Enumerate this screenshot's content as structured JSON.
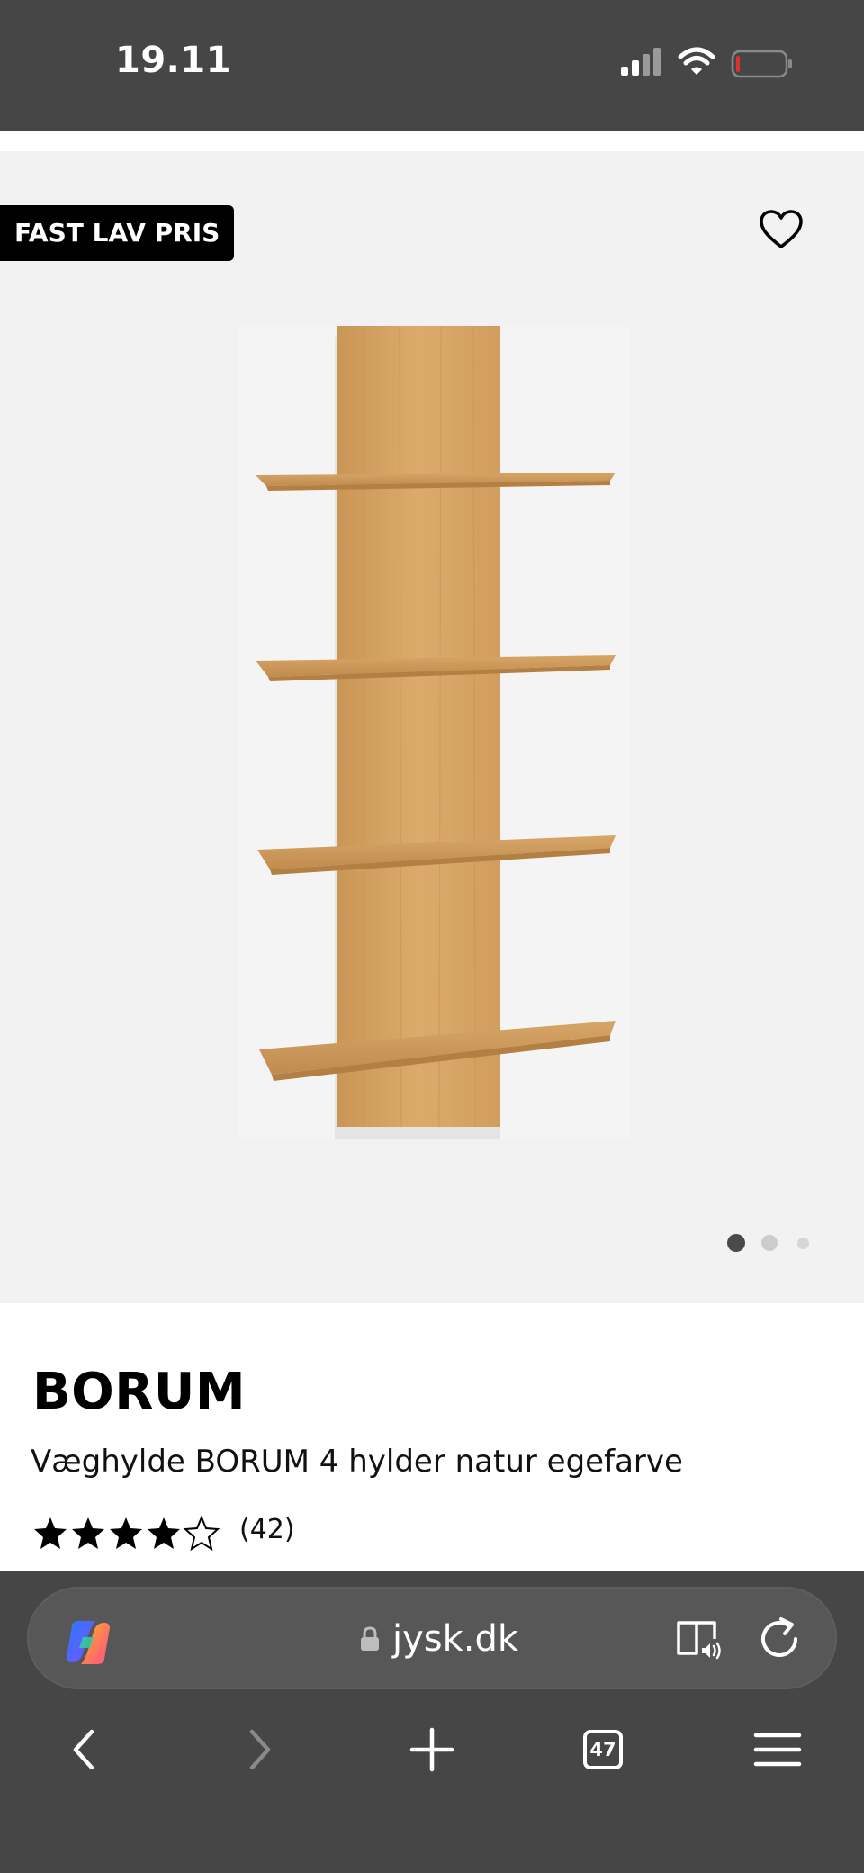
{
  "status_bar": {
    "time": "19.11",
    "signal_icon": "cellular-signal-icon",
    "wifi_icon": "wifi-icon",
    "battery_icon": "battery-low-icon",
    "battery_color": "#e0302a"
  },
  "product": {
    "badge": "FAST LAV PRIS",
    "wishlist_icon": "heart-outline-icon",
    "image_icon": "wall-shelf-image",
    "carousel": {
      "total": 3,
      "active": 1
    },
    "brand": "BORUM",
    "name": "Væghylde BORUM 4 hylder natur egefarve",
    "rating": {
      "stars": 4.5,
      "max": 5,
      "count": "(42)"
    }
  },
  "browser": {
    "url": "jysk.dk",
    "copilot_icon": "copilot-icon",
    "lock_icon": "lock-icon",
    "reader_icon": "reader-audio-icon",
    "reload_icon": "reload-icon",
    "toolbar": {
      "back_icon": "chevron-left-icon",
      "forward_icon": "chevron-right-icon",
      "new_tab_icon": "plus-icon",
      "tabs_count": "47",
      "menu_icon": "hamburger-menu-icon"
    }
  },
  "colors": {
    "chrome_bg": "#464646",
    "url_bar_bg": "#575757",
    "gallery_bg": "#f2f2f2",
    "badge_bg": "#000000",
    "wood": "#d9a86a"
  }
}
